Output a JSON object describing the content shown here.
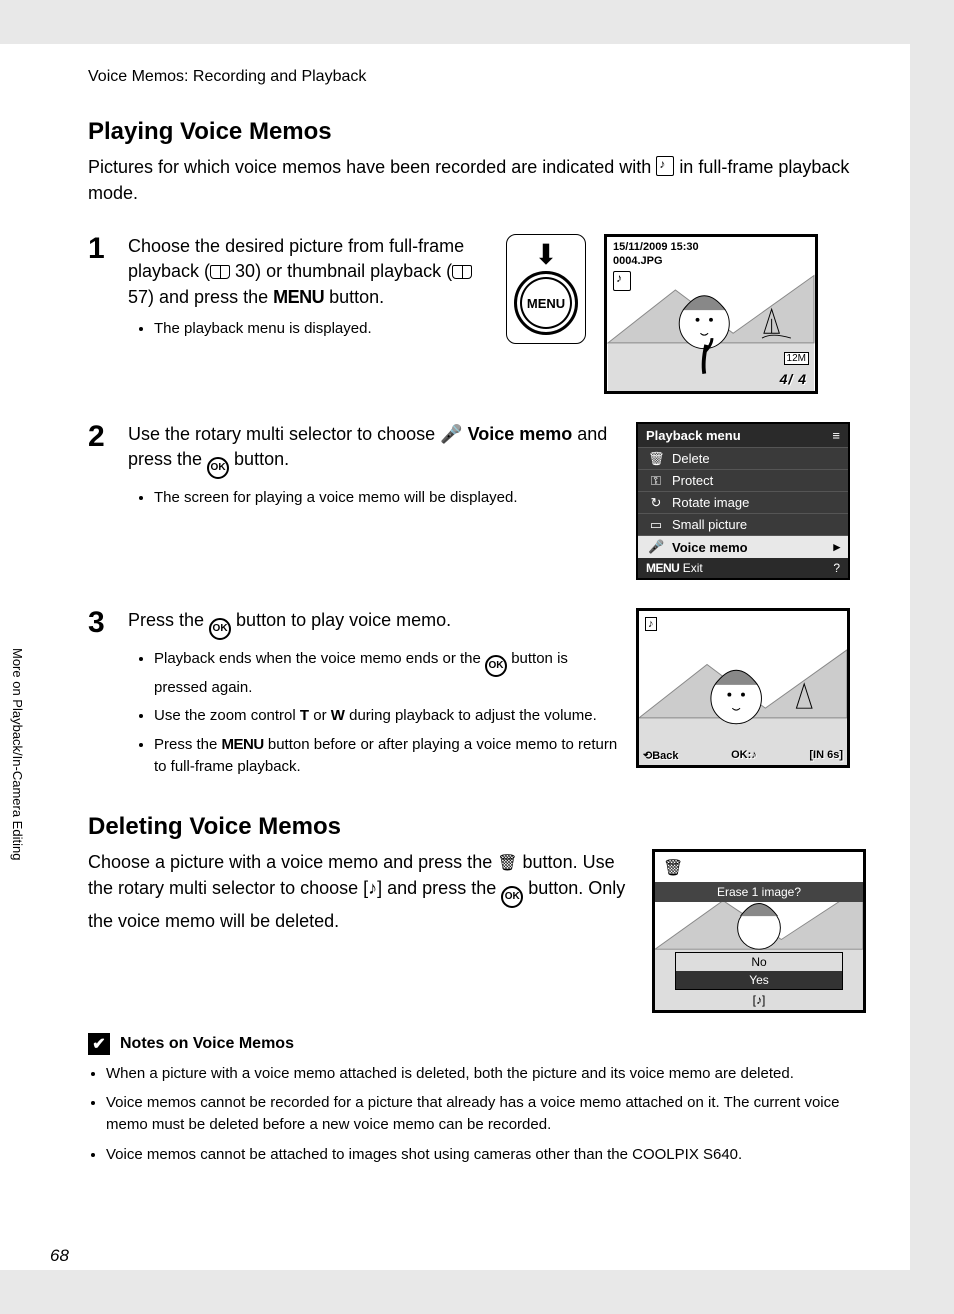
{
  "breadcrumb": "Voice Memos: Recording and Playback",
  "side_tab": "More on Playback/In-Camera Editing",
  "page_number": "68",
  "section_playing": {
    "title": "Playing Voice Memos",
    "intro_a": "Pictures for which voice memos have been recorded are indicated with ",
    "intro_b": " in full-frame playback mode."
  },
  "step1": {
    "num": "1",
    "line1": "Choose the desired picture from full-frame playback (",
    "ref1": " 30) or thumbnail playback (",
    "ref2": " 57) and press the ",
    "menu": "MENU",
    "line4": " button.",
    "sub1": "The playback menu is displayed.",
    "menu_circle": "MENU"
  },
  "lcd1": {
    "date": "15/11/2009 15:30",
    "fname": "0004.JPG",
    "res": "12M",
    "counter": "4/     4"
  },
  "step2": {
    "num": "2",
    "line_a": "Use the rotary multi selector to choose ",
    "mic": "🎤",
    "bold": " Voice memo",
    "line_b": " and press the ",
    "ok": "OK",
    "line_c": " button.",
    "sub1": "The screen for playing a voice memo will be displayed."
  },
  "pbmenu": {
    "title": "Playback menu",
    "items": [
      "Delete",
      "Protect",
      "Rotate image",
      "Small picture",
      "Voice memo"
    ],
    "exit": "Exit",
    "menu": "MENU"
  },
  "step3": {
    "num": "3",
    "line_a": "Press the ",
    "ok": "OK",
    "line_b": " button to play voice memo.",
    "sub1_a": "Playback ends when the voice memo ends or the ",
    "sub1_b": " button is pressed again.",
    "sub2_a": "Use the zoom control ",
    "sub2_t": "T",
    "sub2_mid": " or ",
    "sub2_w": "W",
    "sub2_b": " during playback to adjust the volume.",
    "sub3_a": "Press the ",
    "sub3_menu": "MENU",
    "sub3_b": " button before or after playing a voice memo to return to full-frame playback."
  },
  "lcd2": {
    "back": "Back",
    "ok": "OK",
    "time": "6s",
    "in": "IN"
  },
  "section_delete": {
    "title": "Deleting Voice Memos",
    "p_a": "Choose a picture with a voice memo and press the ",
    "p_b": " button. Use the rotary multi selector to choose ",
    "p_c": " and press the ",
    "ok": "OK",
    "p_d": " button. Only the voice memo will be deleted."
  },
  "lcd3": {
    "prompt": "Erase 1 image?",
    "no": "No",
    "yes": "Yes"
  },
  "notes": {
    "title": "Notes on Voice Memos",
    "items": [
      "When a picture with a voice memo attached is deleted, both the picture and its voice memo are deleted.",
      "Voice memos cannot be recorded for a picture that already has a voice memo attached on it. The current voice memo must be deleted before a new voice memo can be recorded.",
      "Voice memos cannot be attached to images shot using cameras other than the COOLPIX S640."
    ]
  }
}
